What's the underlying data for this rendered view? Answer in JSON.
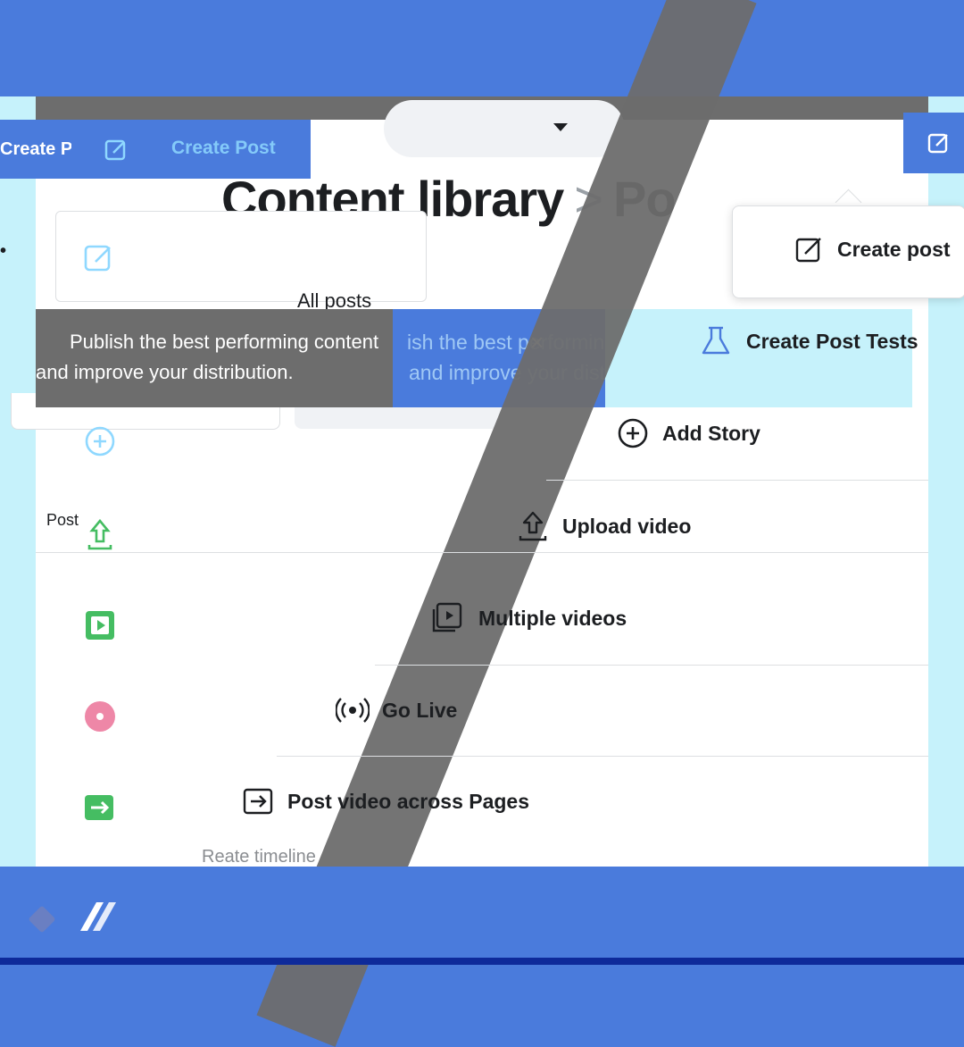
{
  "top_bar": {
    "create_post_button": "Create Post",
    "create_post_ghost": "Create Post"
  },
  "header": {
    "title": "Content library",
    "title_sep": ">",
    "title_tail": "Po"
  },
  "filters": {
    "all_posts": "All posts",
    "side_dot": "•"
  },
  "tooltip": {
    "line1": "Publish the best performing content",
    "line2": "and improve your distribution.",
    "ghost_line1": "ish the best performing co",
    "ghost_line2": "and improve your distribution.",
    "close": "×"
  },
  "dropdown": {
    "create_post": "Create post",
    "create_post_tests": "Create Post Tests",
    "add_story": "Add Story",
    "upload_video": "Upload video",
    "multiple_videos": "Multiple videos",
    "go_live": "Go Live",
    "post_video_across_pages": "Post video across Pages"
  },
  "sidebar": {
    "post_label": "Post",
    "footer_hint": "Reate timeline"
  },
  "colors": {
    "brand_blue": "#4a7bdc",
    "light_cyan": "#c6f2fb",
    "overlay_grey": "#6d6d6d",
    "live_red": "#e0245e",
    "video_green": "#45bd62"
  }
}
